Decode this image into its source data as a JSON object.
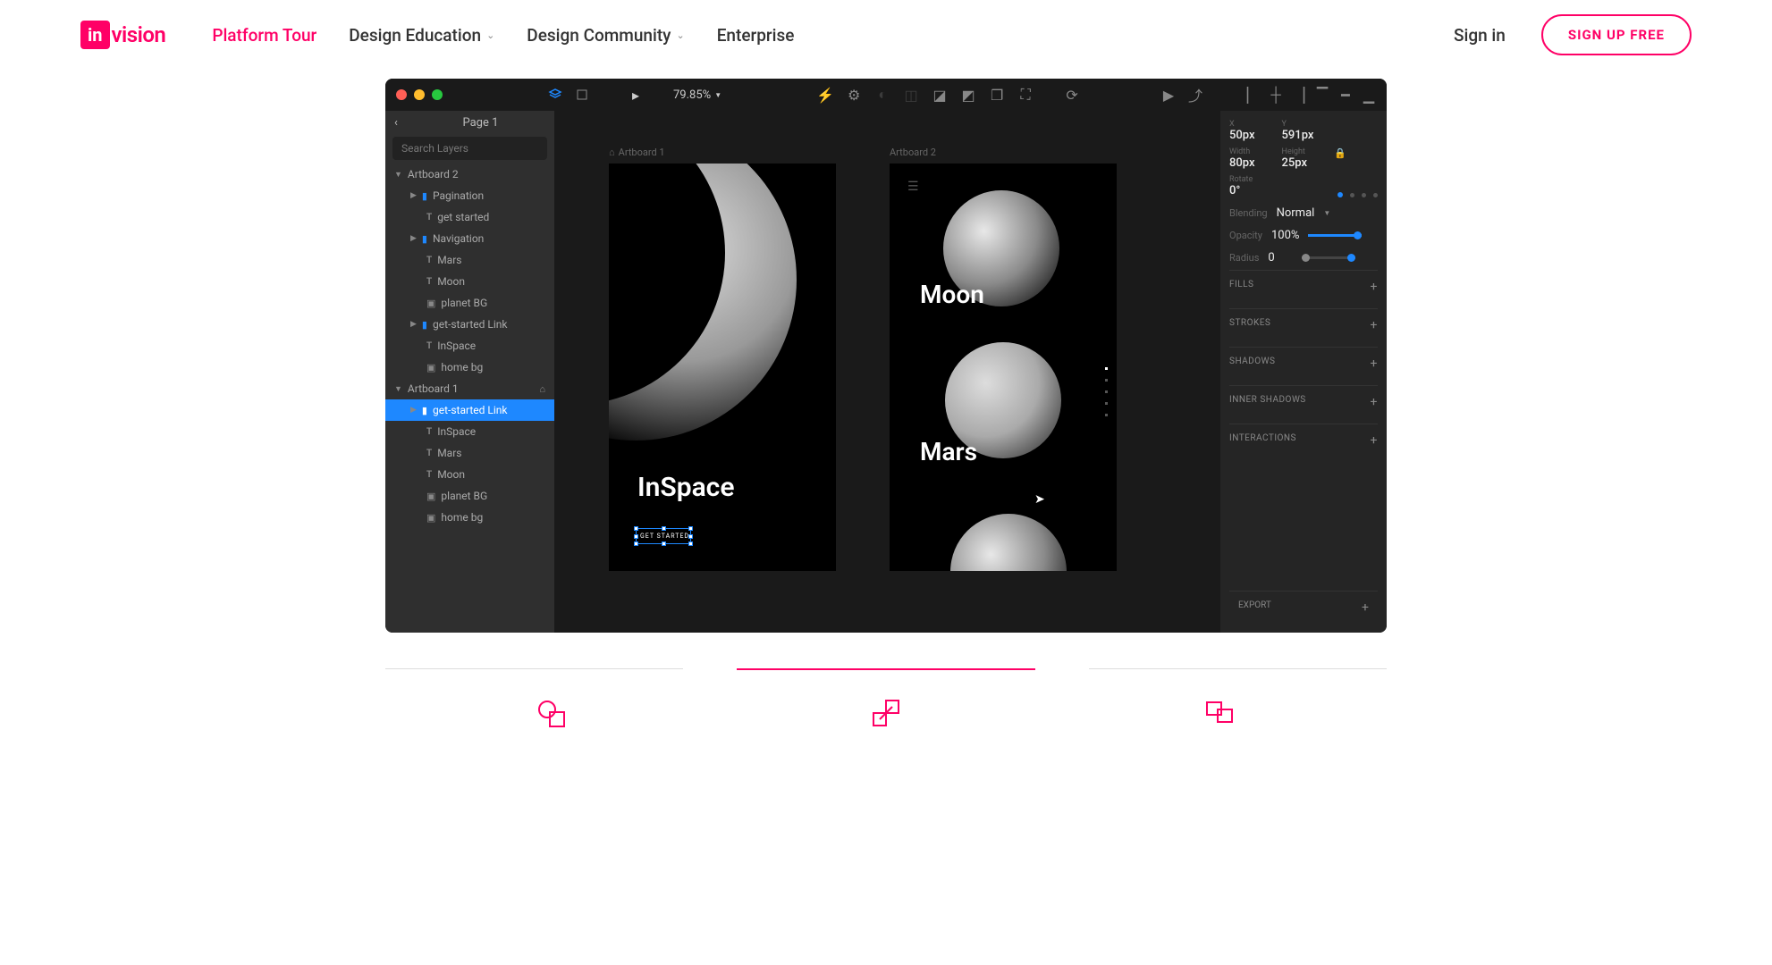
{
  "header": {
    "logo_in": "in",
    "logo_vision": "vision",
    "nav": {
      "platform": "Platform Tour",
      "design_edu": "Design Education",
      "design_com": "Design Community",
      "enterprise": "Enterprise"
    },
    "signin": "Sign in",
    "signup": "SIGN UP FREE"
  },
  "app": {
    "zoom": "79.85%",
    "page_label": "Page 1",
    "search_placeholder": "Search Layers",
    "layers": {
      "ab2": "Artboard 2",
      "pagination": "Pagination",
      "get_started": "get started",
      "navigation": "Navigation",
      "mars": "Mars",
      "moon": "Moon",
      "planet_bg": "planet BG",
      "get_started_link": "get-started Link",
      "inspace": "InSpace",
      "home_bg": "home bg",
      "ab1": "Artboard 1"
    },
    "canvas": {
      "ab1_label": "Artboard 1",
      "ab2_label": "Artboard 2",
      "inspace": "InSpace",
      "get_started": "GET STARTED",
      "moon": "Moon",
      "mars": "Mars"
    },
    "inspector": {
      "x_label": "X",
      "x_val": "50px",
      "y_label": "Y",
      "y_val": "591px",
      "w_label": "Width",
      "w_val": "80px",
      "h_label": "Height",
      "h_val": "25px",
      "rotate_label": "Rotate",
      "rotate_val": "0°",
      "blending_label": "Blending",
      "blending_val": "Normal",
      "opacity_label": "Opacity",
      "opacity_val": "100%",
      "radius_label": "Radius",
      "radius_val": "0",
      "fills": "FILLS",
      "strokes": "STROKES",
      "shadows": "SHADOWS",
      "inner_shadows": "INNER SHADOWS",
      "interactions": "INTERACTIONS",
      "export": "EXPORT"
    }
  }
}
